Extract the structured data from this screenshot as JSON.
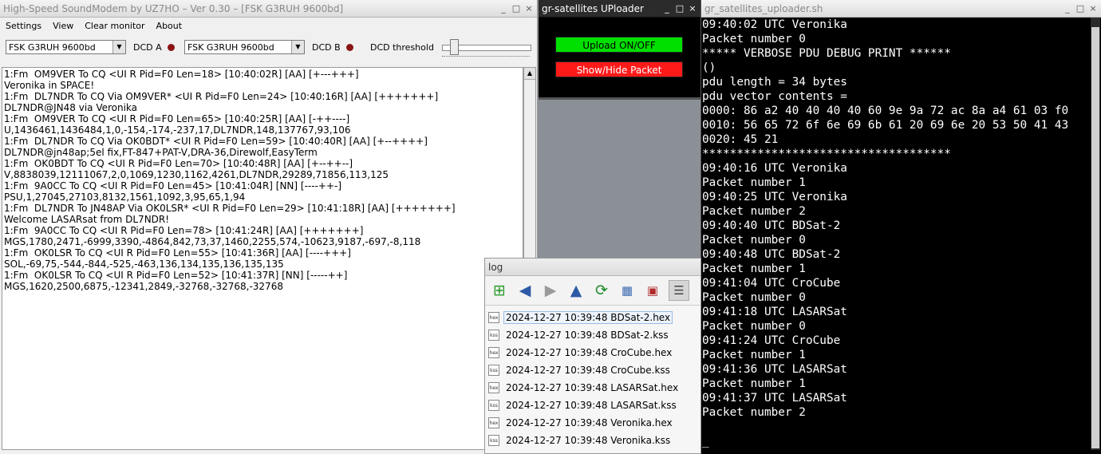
{
  "soundmodem": {
    "title": "High-Speed SoundModem by UZ7HO – Ver 0.30 – [FSK G3RUH 9600bd]",
    "menu": [
      "Settings",
      "View",
      "Clear monitor",
      "About"
    ],
    "modem_a": "FSK G3RUH 9600bd",
    "dcd_a_label": "DCD A",
    "modem_b": "FSK G3RUH 9600bd",
    "dcd_b_label": "DCD B",
    "dcd_threshold_label": "DCD threshold",
    "monitor_text": "1:Fm  OM9VER To CQ <UI R Pid=F0 Len=18> [10:40:02R] [AA] [+---+++]\nVeronika in SPACE!\n1:Fm  DL7NDR To CQ Via OM9VER* <UI R Pid=F0 Len=24> [10:40:16R] [AA] [+++++++]\nDL7NDR@JN48 via Veronika\n1:Fm  OM9VER To CQ <UI R Pid=F0 Len=65> [10:40:25R] [AA] [-++----]\nU,1436461,1436484,1,0,-154,-174,-237,17,DL7NDR,148,137767,93,106\n1:Fm  DL7NDR To CQ Via OK0BDT* <UI R Pid=F0 Len=59> [10:40:40R] [AA] [+--++++]\nDL7NDR@jn48ap;5el fix,FT-847+PAT-V,DRA-36,Direwolf,EasyTerm\n1:Fm  OK0BDT To CQ <UI R Pid=F0 Len=70> [10:40:48R] [AA] [+--++--]\nV,8838039,12111067,2,0,1069,1230,1162,4261,DL7NDR,29289,71856,113,125\n1:Fm  9A0CC To CQ <UI R Pid=F0 Len=45> [10:41:04R] [NN] [----++-]\nPSU,1,27045,27103,8132,1561,1092,3,95,65,1,94\n1:Fm  DL7NDR To JN48AP Via OK0LSR* <UI R Pid=F0 Len=29> [10:41:18R] [AA] [+++++++]\nWelcome LASARsat from DL7NDR!\n1:Fm  9A0CC To CQ <UI R Pid=F0 Len=78> [10:41:24R] [AA] [+++++++]\nMGS,1780,2471,-6999,3390,-4864,842,73,37,1460,2255,574,-10623,9187,-697,-8,118\n1:Fm  OK0LSR To CQ <UI R Pid=F0 Len=55> [10:41:36R] [AA] [----+++]\nSOL,-69,75,-544,-844,-525,-463,136,134,135,136,135,135\n1:Fm  OK0LSR To CQ <UI R Pid=F0 Len=52> [10:41:37R] [NN] [-----++]\nMGS,1620,2500,6875,-12341,2849,-32768,-32768,-32768"
  },
  "uploader": {
    "title": "gr-satellites UPloader",
    "upload_button": "Upload ON/OFF",
    "show_hide_button": "Show/Hide Packet"
  },
  "terminal": {
    "title": "gr_satellites_uploader.sh",
    "text": "09:40:02 UTC Veronika\nPacket number 0\n***** VERBOSE PDU DEBUG PRINT ******\n()\npdu length = 34 bytes\npdu vector contents =\n0000: 86 a2 40 40 40 40 60 9e 9a 72 ac 8a a4 61 03 f0\n0010: 56 65 72 6f 6e 69 6b 61 20 69 6e 20 53 50 41 43\n0020: 45 21\n************************************\n09:40:16 UTC Veronika\nPacket number 1\n09:40:25 UTC Veronika\nPacket number 2\n09:40:40 UTC BDSat-2\nPacket number 0\n09:40:48 UTC BDSat-2\nPacket number 1\n09:41:04 UTC CroCube\nPacket number 0\n09:41:18 UTC LASARSat\nPacket number 0\n09:41:24 UTC CroCube\nPacket number 1\n09:41:36 UTC LASARSat\nPacket number 1\n09:41:37 UTC LASARSat\nPacket number 2\n\n_"
  },
  "log": {
    "title": "log",
    "files": [
      {
        "name": "2024-12-27 10:39:48 BDSat-2.hex",
        "icon": "hex"
      },
      {
        "name": "2024-12-27 10:39:48 BDSat-2.kss",
        "icon": "kss"
      },
      {
        "name": "2024-12-27 10:39:48 CroCube.hex",
        "icon": "hex"
      },
      {
        "name": "2024-12-27 10:39:48 CroCube.kss",
        "icon": "kss"
      },
      {
        "name": "2024-12-27 10:39:48 LASARSat.hex",
        "icon": "hex"
      },
      {
        "name": "2024-12-27 10:39:48 LASARSat.kss",
        "icon": "kss"
      },
      {
        "name": "2024-12-27 10:39:48 Veronika.hex",
        "icon": "hex"
      },
      {
        "name": "2024-12-27 10:39:48 Veronika.kss",
        "icon": "kss"
      }
    ]
  }
}
